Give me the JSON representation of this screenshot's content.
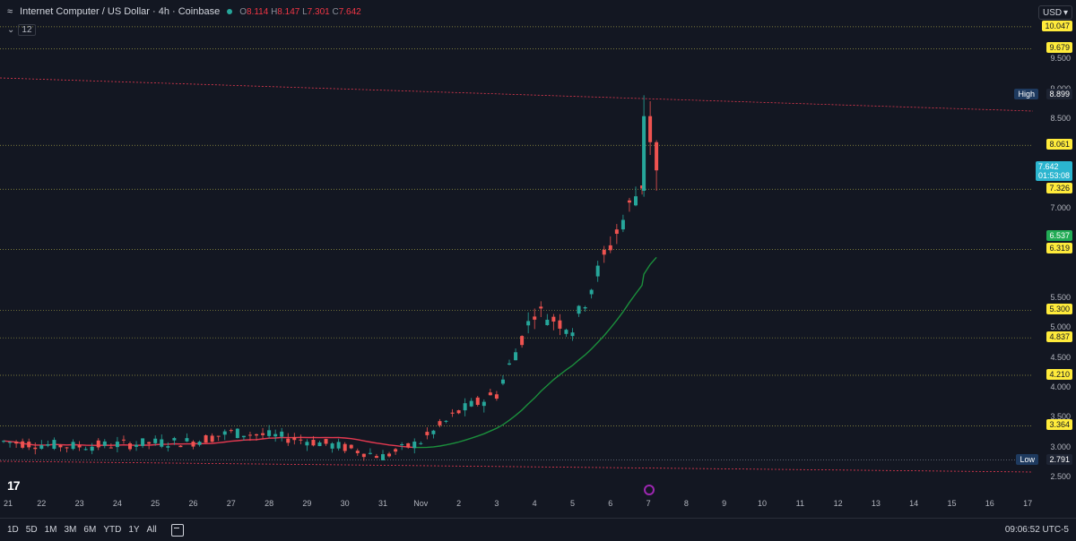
{
  "header": {
    "symbol_glyph": "≈",
    "title": "Internet Computer / US Dollar · 4h · Coinbase",
    "open_label": "O",
    "open": "8.114",
    "high_label": "H",
    "high": "8.147",
    "low_label": "L",
    "low": "7.301",
    "close_label": "C",
    "close": "7.642",
    "indicator_count": "12",
    "currency": "USD"
  },
  "price_axis": {
    "ticks": [
      "9.500",
      "9.000",
      "8.500",
      "7.000",
      "5.500",
      "5.000",
      "4.500",
      "4.000",
      "3.500",
      "3.000",
      "2.500"
    ],
    "tags": [
      {
        "value": "10.047",
        "style": "yellow"
      },
      {
        "value": "9.679",
        "style": "yellow"
      },
      {
        "value": "8.899",
        "style": "dark"
      },
      {
        "value": "8.061",
        "style": "yellow"
      },
      {
        "value": "7.642",
        "style": "cyan"
      },
      {
        "value": "7.326",
        "style": "yellow"
      },
      {
        "value": "6.537",
        "style": "green"
      },
      {
        "value": "6.319",
        "style": "yellow"
      },
      {
        "value": "5.300",
        "style": "yellow"
      },
      {
        "value": "4.837",
        "style": "yellow"
      },
      {
        "value": "4.210",
        "style": "yellow"
      },
      {
        "value": "3.364",
        "style": "yellow"
      },
      {
        "value": "2.791",
        "style": "dark"
      }
    ],
    "countdown": "01:53:08",
    "high_label": "High",
    "low_label": "Low"
  },
  "time_axis": [
    "21",
    "22",
    "23",
    "24",
    "25",
    "26",
    "27",
    "28",
    "29",
    "30",
    "31",
    "Nov",
    "2",
    "3",
    "4",
    "5",
    "6",
    "7",
    "8",
    "9",
    "10",
    "11",
    "12",
    "13",
    "14",
    "15",
    "16",
    "17"
  ],
  "bottom": {
    "ranges": [
      "1D",
      "5D",
      "1M",
      "3M",
      "6M",
      "YTD",
      "1Y",
      "All"
    ],
    "clock": "09:06:52 UTC-5"
  },
  "chart_data": {
    "type": "candlestick",
    "symbol": "Internet Computer / US Dollar",
    "interval": "4h",
    "exchange": "Coinbase",
    "x": [
      "Oct 21",
      "Oct 22",
      "Oct 23",
      "Oct 24",
      "Oct 25",
      "Oct 26",
      "Oct 27",
      "Oct 28",
      "Oct 29",
      "Oct 30",
      "Oct 31",
      "Nov 1",
      "Nov 2",
      "Nov 3",
      "Nov 4",
      "Nov 5",
      "Nov 6",
      "Nov 7"
    ],
    "close_approx": [
      3.1,
      3.05,
      3.02,
      3.05,
      3.08,
      3.1,
      3.25,
      3.2,
      3.12,
      3.0,
      2.85,
      3.1,
      3.6,
      3.9,
      5.3,
      5.0,
      6.4,
      7.642
    ],
    "high": 8.899,
    "low": 2.791,
    "last": 7.642,
    "levels": [
      10.047,
      9.679,
      8.061,
      7.326,
      6.319,
      5.3,
      4.837,
      4.21,
      3.364
    ],
    "ylim": [
      2.3,
      10.3
    ],
    "grid": false,
    "colors": {
      "up": "#26a69a",
      "down": "#ef5350",
      "ma": "#1b8f3c",
      "level": "#9e9b44",
      "trend": "#e53950",
      "bg": "#131722"
    }
  }
}
